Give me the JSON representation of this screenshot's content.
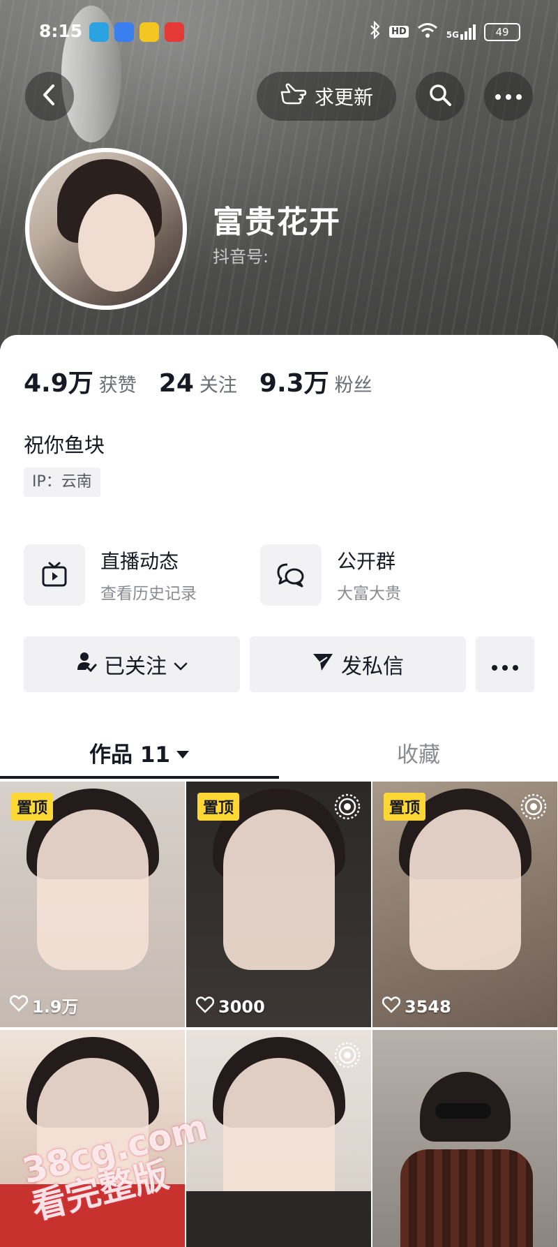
{
  "status_bar": {
    "time": "8:15",
    "network": "5G",
    "hd": "HD",
    "battery": "49",
    "app_icons": [
      "telegram-icon",
      "blue-app-icon",
      "yellow-app-icon",
      "red-app-icon"
    ]
  },
  "header": {
    "request_update_label": "求更新"
  },
  "profile": {
    "nickname": "富贵花开",
    "douyin_id_label": "抖音号:",
    "stats": [
      {
        "value": "4.9万",
        "label": "获赞"
      },
      {
        "value": "24",
        "label": "关注"
      },
      {
        "value": "9.3万",
        "label": "粉丝"
      }
    ],
    "bio": "祝你鱼块",
    "ip": "IP：云南"
  },
  "features": [
    {
      "title": "直播动态",
      "subtitle": "查看历史记录",
      "icon": "tv-icon"
    },
    {
      "title": "公开群",
      "subtitle": "大富大贵",
      "icon": "chat-group-icon"
    }
  ],
  "actions": {
    "follow_label": "已关注",
    "message_label": "发私信"
  },
  "tabs": {
    "works_label": "作品 11",
    "favorites_label": "收藏"
  },
  "videos": [
    {
      "pinned": "置顶",
      "likes": "1.9万",
      "live": false,
      "bg": "#cfc6bf"
    },
    {
      "pinned": "置顶",
      "likes": "3000",
      "live": true,
      "bg": "#2d2a28"
    },
    {
      "pinned": "置顶",
      "likes": "3548",
      "live": true,
      "bg": "#8d7d72"
    },
    {
      "pinned": "",
      "likes": "",
      "live": false,
      "bg": "#e4d6cc"
    },
    {
      "pinned": "",
      "likes": "",
      "live": true,
      "bg": "#ddd6cf"
    },
    {
      "pinned": "",
      "likes": "",
      "live": false,
      "bg": "#9d9993"
    }
  ],
  "watermark": {
    "line1": "38cg.com",
    "line2": "看完整版"
  },
  "colors": {
    "pin_badge": "#fdd835",
    "primary_text": "#161823",
    "secondary_text": "#8a8b91",
    "button_bg": "#f1f1f3"
  }
}
